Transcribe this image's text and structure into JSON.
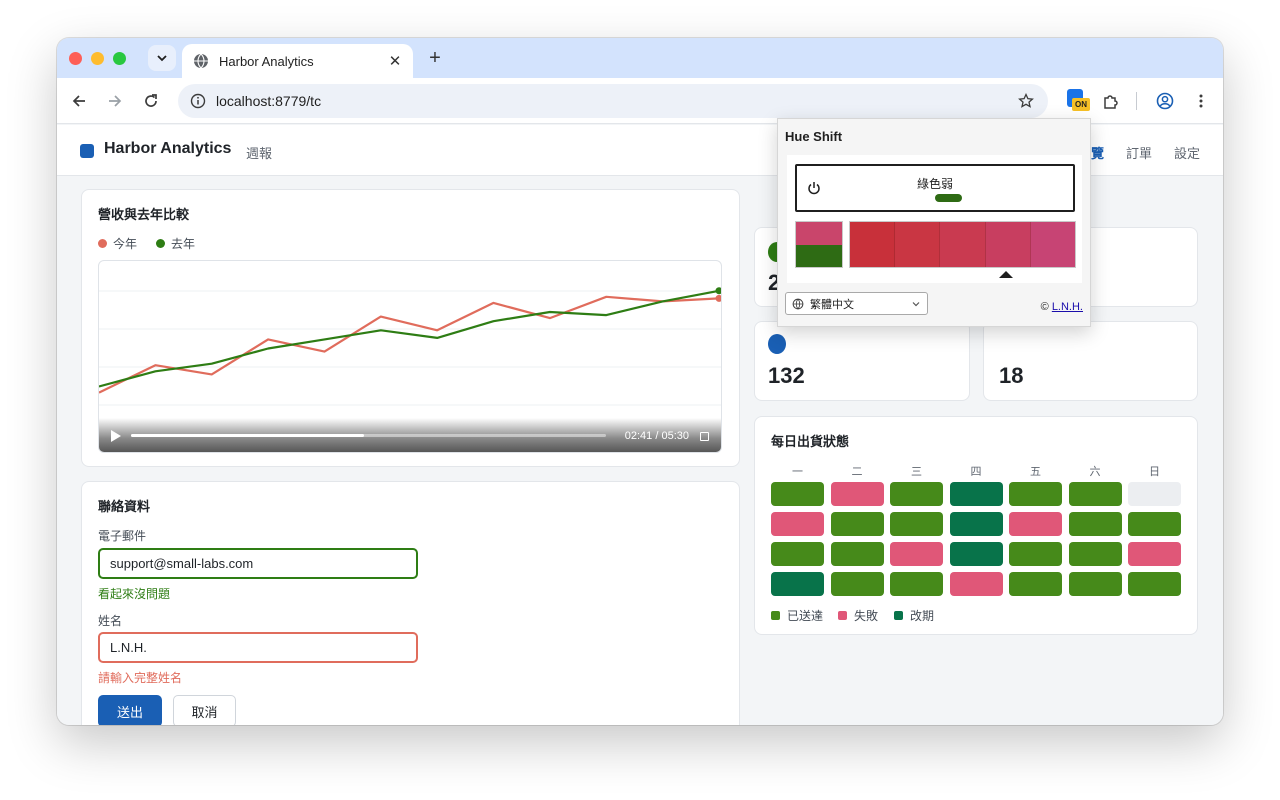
{
  "browser": {
    "tab_title": "Harbor Analytics",
    "tab_close": "✕",
    "new_tab": "+",
    "url": "localhost:8779/tc",
    "extension_badge": "ON"
  },
  "app": {
    "title": "Harbor Analytics",
    "subtitle": "週報",
    "nav": [
      "覽",
      "訂單",
      "設定"
    ]
  },
  "revenue_card": {
    "title": "營收與去年比較",
    "legend": [
      {
        "label": "今年",
        "color": "#e06c5c"
      },
      {
        "label": "去年",
        "color": "#2e7d14"
      }
    ],
    "video_time": "02:41 / 05:30",
    "video_progress": 0.49
  },
  "chart_data": {
    "type": "line",
    "x": [
      0,
      1,
      2,
      3,
      4,
      5,
      6,
      7,
      8,
      9,
      10,
      11
    ],
    "ylim": [
      0,
      100
    ],
    "series": [
      {
        "name": "今年",
        "color": "#e06c5c",
        "values": [
          20,
          38,
          32,
          55,
          47,
          70,
          61,
          79,
          69,
          83,
          80,
          82
        ]
      },
      {
        "name": "去年",
        "color": "#2e7d14",
        "values": [
          24,
          34,
          39,
          49,
          55,
          61,
          56,
          67,
          73,
          71,
          80,
          87
        ]
      }
    ]
  },
  "contact_card": {
    "title": "聯絡資料",
    "email_label": "電子郵件",
    "email_value": "support@small-labs.com",
    "email_help": "看起來沒問題",
    "name_label": "姓名",
    "name_value": "L.N.H.",
    "name_help": "請輸入完整姓名",
    "submit": "送出",
    "cancel": "取消"
  },
  "stats": [
    {
      "value": "2",
      "color": "#2e7d14"
    },
    {
      "value": "132",
      "color": "#1a5fb4"
    },
    {
      "value": "18",
      "color": "#1a5fb4"
    }
  ],
  "shipping_card": {
    "title": "每日出貨狀態",
    "days": [
      "一",
      "二",
      "三",
      "四",
      "五",
      "六",
      "日"
    ],
    "status_colors": {
      "delivered": "#468a1a",
      "failed": "#e05778",
      "rescheduled": "#08734a",
      "none": "#eceef1"
    },
    "grid": [
      [
        "delivered",
        "failed",
        "delivered",
        "rescheduled",
        "delivered",
        "delivered",
        "none"
      ],
      [
        "failed",
        "delivered",
        "delivered",
        "rescheduled",
        "failed",
        "delivered",
        "delivered"
      ],
      [
        "delivered",
        "delivered",
        "failed",
        "rescheduled",
        "delivered",
        "delivered",
        "failed"
      ],
      [
        "rescheduled",
        "delivered",
        "delivered",
        "failed",
        "delivered",
        "delivered",
        "delivered"
      ]
    ],
    "legend": [
      {
        "label": "已送達",
        "color": "#468a1a"
      },
      {
        "label": "失敗",
        "color": "#e05778"
      },
      {
        "label": "改期",
        "color": "#08734a"
      }
    ]
  },
  "hue_popup": {
    "title": "Hue Shift",
    "mode": "綠色弱",
    "sample_colors": [
      "#c9456b",
      "#2e6b14"
    ],
    "swatches": [
      "#c8303a",
      "#c93643",
      "#c93a50",
      "#c83e60",
      "#c74474"
    ],
    "selected_swatch": 3,
    "language": "繁體中文",
    "credit_symbol": "©",
    "credit_name": "L.N.H."
  }
}
